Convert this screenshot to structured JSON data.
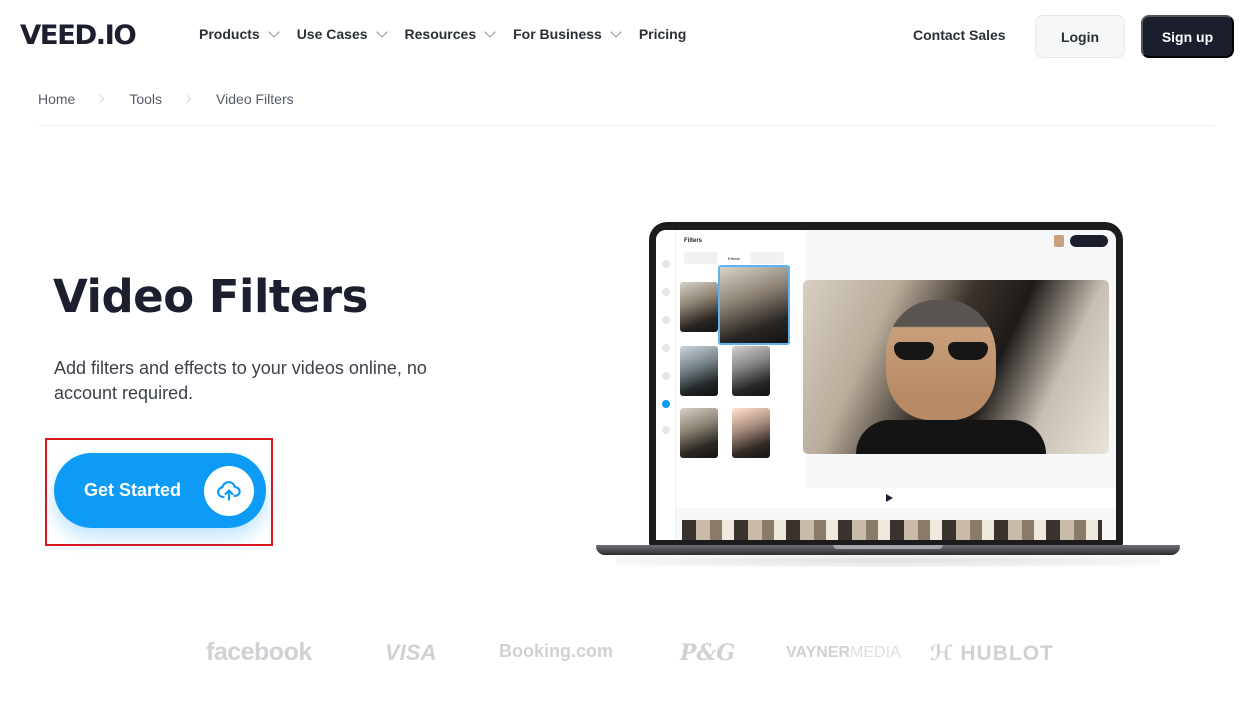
{
  "nav": {
    "logo": "VEED.IO",
    "menu": [
      {
        "label": "Products",
        "has_dropdown": true
      },
      {
        "label": "Use Cases",
        "has_dropdown": true
      },
      {
        "label": "Resources",
        "has_dropdown": true
      },
      {
        "label": "For Business",
        "has_dropdown": true
      },
      {
        "label": "Pricing",
        "has_dropdown": false
      }
    ],
    "contact_label": "Contact Sales",
    "login_label": "Login",
    "signup_label": "Sign up"
  },
  "breadcrumb": [
    "Home",
    "Tools",
    "Video Filters"
  ],
  "hero": {
    "title": "Video Filters",
    "subtitle": "Add filters and effects to your videos online, no account required.",
    "cta_label": "Get Started",
    "cta_icon": "cloud-upload-icon"
  },
  "mockup": {
    "panel_title": "Filters",
    "tabs": [
      "",
      "Effects",
      ""
    ],
    "active_tab": 1
  },
  "brands": [
    {
      "name": "facebook"
    },
    {
      "name": "VISA"
    },
    {
      "name": "Booking.com"
    },
    {
      "name": "P&G"
    },
    {
      "name": "VAYNER",
      "suffix": "MEDIA"
    },
    {
      "name": "HUBLOT"
    }
  ],
  "colors": {
    "primary": "#0d9bf5",
    "dark": "#1a1e2d",
    "highlight": "#d9151d"
  }
}
